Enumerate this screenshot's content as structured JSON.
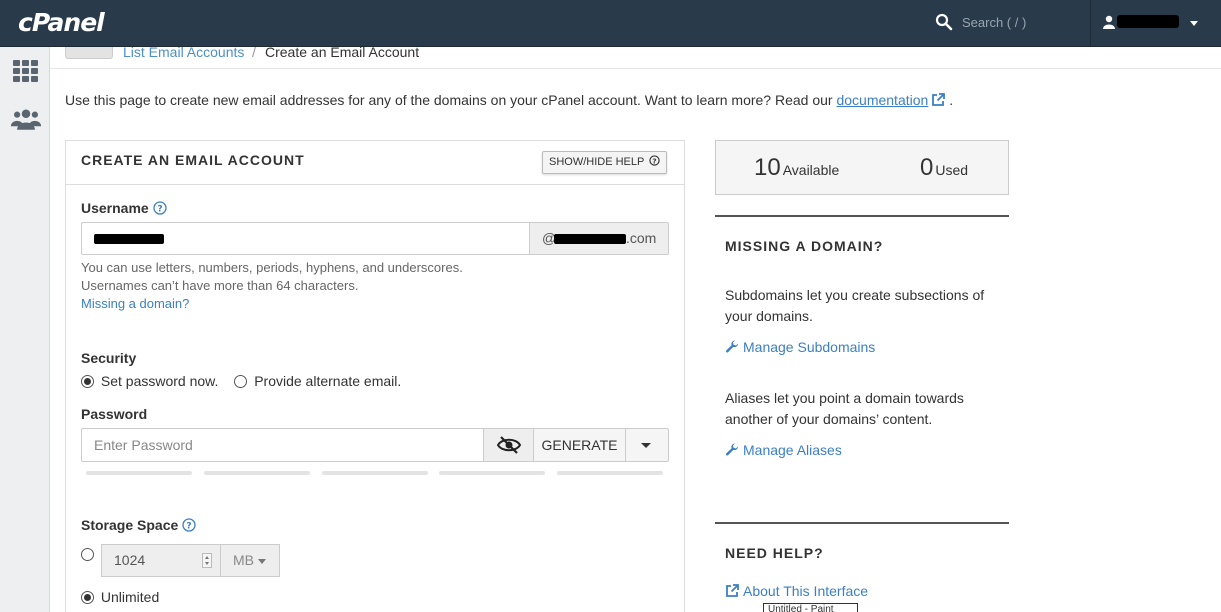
{
  "topbar": {
    "logo": "cPanel",
    "search_placeholder": "Search ( / )"
  },
  "breadcrumb": {
    "parent": "List Email Accounts",
    "separator": "/",
    "current": "Create an Email Account"
  },
  "intro": {
    "text": "Use this page to create new email addresses for any of the domains on your cPanel account. Want to learn more? Read our",
    "link": "documentation",
    "end": "."
  },
  "form": {
    "title": "CREATE AN EMAIL ACCOUNT",
    "help_button": "SHOW/HIDE HELP",
    "username_label": "Username",
    "domain_at": "@",
    "domain_tld": ".com",
    "hint1": "You can use letters, numbers, periods, hyphens, and underscores.",
    "hint2": "Usernames can’t have more than 64 characters.",
    "missing_domain_link": "Missing a domain?",
    "security_label": "Security",
    "radio_set_password": "Set password now.",
    "radio_alt_email": "Provide alternate email.",
    "password_label": "Password",
    "password_placeholder": "Enter Password",
    "generate_button": "GENERATE",
    "storage_label": "Storage Space",
    "storage_value": "1024",
    "storage_unit": "MB",
    "unlimited_label": "Unlimited"
  },
  "stats": {
    "available_count": "10",
    "available_label": "Available",
    "used_count": "0",
    "used_label": "Used"
  },
  "missing_domain": {
    "title": "MISSING A DOMAIN?",
    "subdomains_text": "Subdomains let you create subsections of your domains.",
    "subdomains_link": "Manage Subdomains",
    "aliases_text": "Aliases let you point a domain towards another of your domains’ content.",
    "aliases_link": "Manage Aliases"
  },
  "need_help": {
    "title": "NEED HELP?",
    "about_link": "About This Interface"
  },
  "tooltip": "Untitled - Paint",
  "colors": {
    "topbar": "#293a4a",
    "link": "#3b7fc4",
    "sidebar": "#edeff1"
  }
}
